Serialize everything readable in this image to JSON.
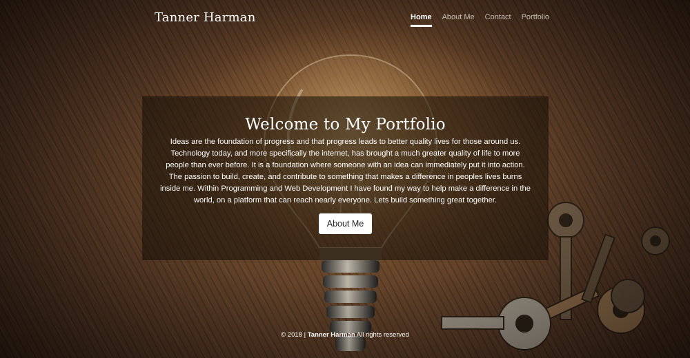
{
  "header": {
    "brand": "Tanner Harman",
    "nav": [
      "Home",
      "About Me",
      "Contact",
      "Portfolio"
    ],
    "active_nav": "Home"
  },
  "hero": {
    "title": "Welcome to My Portfolio",
    "body": "Ideas are the foundation of progress and that progress leads to better quality lives for those around us. Technology today, and more specifically the internet, has brought a much greater quality of life to more people than ever before. It is a foundation where someone with an idea can immediately put it into action. The passion to build, create, and contribute to something that makes a difference in peoples lives burns inside me. Within Programming and Web Development I have found my way to help make a difference in the world, on a platform that can reach nearly everyone. Lets build something great together.",
    "button_label": "About Me"
  },
  "footer": {
    "prefix": "© 2018 |",
    "name": "Tanner Harman",
    "suffix": "All rights reserved"
  },
  "colors": {
    "text": "#ffffff",
    "nav_inactive": "#c9c0b6",
    "overlay": "rgba(18,12,6,0.55)",
    "button_bg": "#ffffff"
  },
  "background": {
    "icons": [
      "lightbulb-icon",
      "keys-icon"
    ]
  }
}
